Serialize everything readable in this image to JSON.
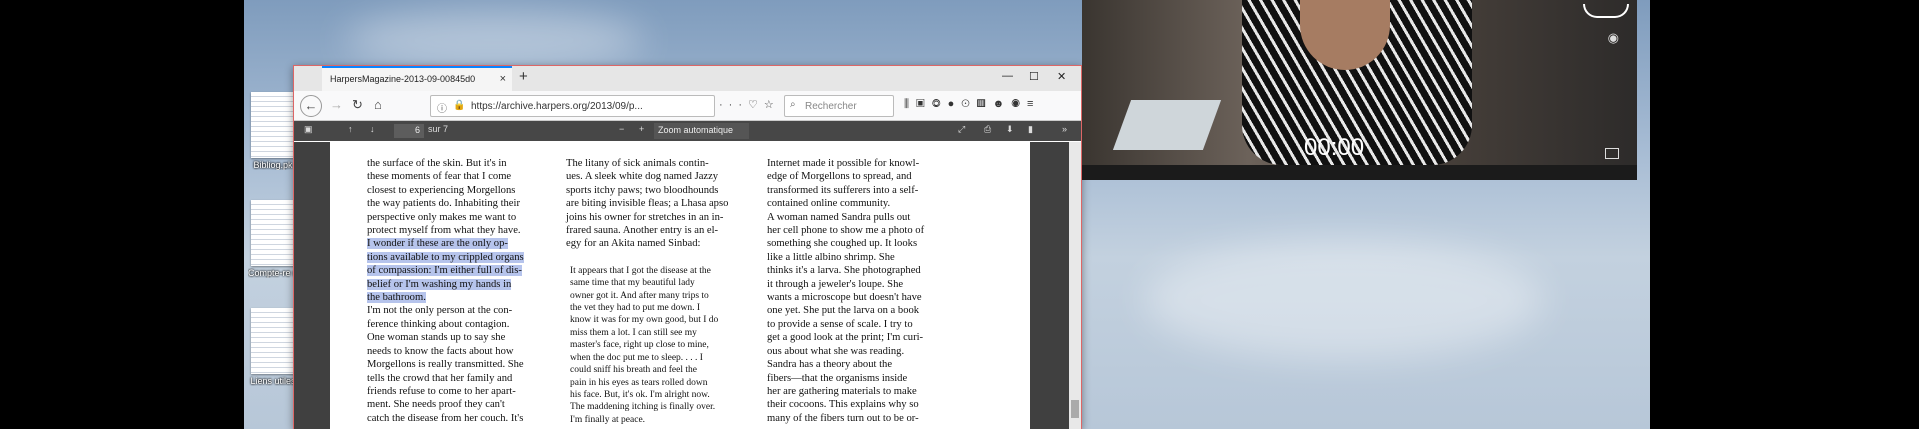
{
  "desktop": {
    "icons": [
      {
        "caption": "Bibliog.pk"
      },
      {
        "caption": "Compte-re nutrion 2 d"
      },
      {
        "caption": "Liens utiles"
      }
    ]
  },
  "browser": {
    "tab_title": "HarpersMagazine-2013-09-00845d0",
    "tab_close": "×",
    "new_tab": "+",
    "url": "https://archive.harpers.org/2013/09/p...",
    "search_placeholder": "Rechercher",
    "window_controls": {
      "minimize": "—",
      "maximize": "☐",
      "close": "✕"
    }
  },
  "pdf_toolbar": {
    "page_current": "6",
    "page_total": "sur 7",
    "zoom": "Zoom automatique"
  },
  "document": {
    "col1_p1_before": "the surface of the skin. But it's in\nthese moments of fear that I come\nclosest to experiencing Morgellons\nthe way patients do. Inhabiting their\nperspective only makes me want to\nprotect myself from what they have.",
    "col1_p1_highlight": "I wonder if these are the only op-\ntions available to my crippled organs\nof compassion: I'm either full of dis-\nbelief or I'm washing my hands in\nthe bathroom.",
    "col1_p2": "I'm not the only person at the con-\nference thinking about contagion.\nOne woman stands up to say she\nneeds to know the facts about how\nMorgellons is really transmitted. She\ntells the crowd that her family and\nfriends refuse to come to her apart-\nment. She needs proof they can't\ncatch the disease from her couch. It's",
    "col2_p1": "The litany of sick animals contin-\nues. A sleek white dog named Jazzy\nsports itchy paws; two bloodhounds\nare biting invisible fleas; a Lhasa apso\njoins his owner for stretches in an in-\nfrared sauna. Another entry is an el-\negy for an Akita named Sinbad:",
    "col2_quote": "It appears that I got the disease at the\nsame time that my beautiful lady\nowner got it. And after many trips to\nthe vet they had to put me down. I\nknow it was for my own good, but I do\nmiss them a lot. I can still see my\nmaster's face, right up close to mine,\nwhen the doc put me to sleep. . . . I\ncould sniff his breath and feel the\npain in his eyes as tears rolled down\nhis face. But, it's ok. I'm alright now.\nThe maddening itching is finally over.\nI'm finally at peace.",
    "col3_p1": "Internet made it possible for knowl-\nedge of Morgellons to spread, and\ntransformed its sufferers into a self-\ncontained online community.",
    "col3_p2": "A woman named Sandra pulls out\nher cell phone to show me a photo of\nsomething she coughed up. It looks\nlike a little albino shrimp. She\nthinks it's a larva. She photographed\nit through a jeweler's loupe. She\nwants a microscope but doesn't have\none yet. She put the larva on a book\nto provide a sense of scale. I try to\nget a good look at the print; I'm curi-\nous about what she was reading.",
    "col3_p3": "Sandra has a theory about the\nfibers—that the organisms inside\nher are gathering materials to make\ntheir cocoons. This explains why so\nmany of the fibers turn out to be or-"
  },
  "video": {
    "timer": "00:00"
  }
}
